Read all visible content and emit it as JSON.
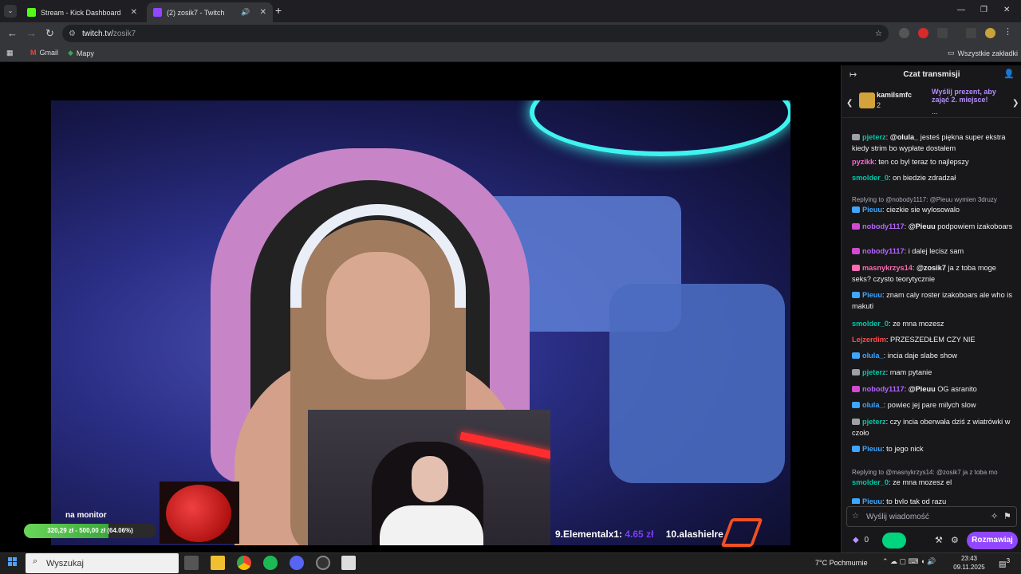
{
  "browser": {
    "tabs": [
      {
        "title": "Stream - Kick Dashboard",
        "favicon_color": "#53fc18"
      },
      {
        "title": "(2) zosik7 - Twitch",
        "favicon_color": "#9147ff"
      }
    ],
    "url_host": "twitch.tv/",
    "url_path": "zosik7",
    "bookmarks": [
      "Gmail",
      "Mapy"
    ],
    "all_bookmarks": "Wszystkie zakładki"
  },
  "stream": {
    "donation_label": "na monitor",
    "donation_text": "320,29 zł - 500,00 zł (64.06%)",
    "donation_progress": 0.6406,
    "ticker_1_name": "9.Elementalx1: ",
    "ticker_1_amount": "4.65 zł",
    "ticker_2_name": "10.alashielre"
  },
  "chat": {
    "header": "Czat transmisji",
    "hype_user": "kamilsmfc",
    "hype_count": "2",
    "hype_cta": "Wyślij prezent, aby zająć 2. miejsce!",
    "hype_ellipsis": "...",
    "input_placeholder": "Wyślij wiadomość",
    "points": "0",
    "send_label": "Rozmawiaj",
    "messages": [
      {
        "user": "pjeterz",
        "color": "#00c8a8",
        "badge": "#9ea0a6",
        "mention": "@olula_",
        "text": " jesteś piękna super ekstra kiedy strim bo wypłate dostałem"
      },
      {
        "user": "pyzikk",
        "color": "#ff69d8",
        "badge": "",
        "mention": "",
        "text": "ten co byl teraz to najlepszy"
      },
      {
        "user": "smolder_0",
        "color": "#00c8a8",
        "badge": "",
        "mention": "",
        "text": "on biedzie zdradzał"
      },
      {
        "reply": "Replying to @nobody1117: @Pieuu wymien 3druzy"
      },
      {
        "user": "Pieuu",
        "color": "#3ea6ff",
        "badge": "#3ea6ff",
        "mention": "",
        "text": "ciezkie sie wylosowalo"
      },
      {
        "user": "nobody1117",
        "color": "#b565ff",
        "badge": "#d14bd1",
        "mention": "@Pieuu",
        "text": " podpowiem izakoboars"
      },
      {
        "user": "nobody1117",
        "color": "#b565ff",
        "badge": "#d14bd1",
        "mention": "",
        "text": "i dalej lecisz sam"
      },
      {
        "user": "masnykrzys14",
        "color": "#ff6ab0",
        "badge": "#ff6ab0",
        "mention": "@zosik7",
        "text": " ja z toba moge seks? czysto teorytycznie"
      },
      {
        "user": "Pieuu",
        "color": "#3ea6ff",
        "badge": "#3ea6ff",
        "mention": "",
        "text": "znam caly roster izakoboars ale who    is makuti"
      },
      {
        "user": "smolder_0",
        "color": "#00c8a8",
        "badge": "",
        "mention": "",
        "text": "ze mna mozesz"
      },
      {
        "user": "Lejzerdim",
        "color": "#ff4b4b",
        "badge": "",
        "mention": "",
        "text": "PRZESZEDŁEM CZY NIE"
      },
      {
        "user": "olula_",
        "color": "#3ea6ff",
        "badge": "#3ea6ff",
        "mention": "",
        "text": "incia daje slabe show"
      },
      {
        "user": "pjeterz",
        "color": "#00c8a8",
        "badge": "#9ea0a6",
        "mention": "",
        "text": "mam pytanie"
      },
      {
        "user": "nobody1117",
        "color": "#b565ff",
        "badge": "#d14bd1",
        "mention": "@Pieuu",
        "text": " OG asranito"
      },
      {
        "user": "olula_",
        "color": "#3ea6ff",
        "badge": "#3ea6ff",
        "mention": "",
        "text": "powiec jej pare milych slow"
      },
      {
        "user": "pjeterz",
        "color": "#00c8a8",
        "badge": "#9ea0a6",
        "mention": "",
        "text": "czy incia oberwała dziś z wiatrówki w czoło"
      },
      {
        "user": "Pieuu",
        "color": "#3ea6ff",
        "badge": "#3ea6ff",
        "mention": "",
        "text": "     to jego nick"
      },
      {
        "reply": "Replying to @masnykrzys14: @zosik7 ja z toba mo"
      },
      {
        "user": "smolder_0",
        "color": "#00c8a8",
        "badge": "",
        "mention": "",
        "text": "ze mna mozesz el"
      },
      {
        "user": "Pieuu",
        "color": "#3ea6ff",
        "badge": "#3ea6ff",
        "mention": "",
        "text": "to bylo tak od razu"
      }
    ]
  },
  "taskbar": {
    "search_placeholder": "Wyszukaj",
    "weather": "7°C  Pochmurnie",
    "time": "23:43",
    "date": "09.11.2025",
    "notif_count": "3"
  }
}
